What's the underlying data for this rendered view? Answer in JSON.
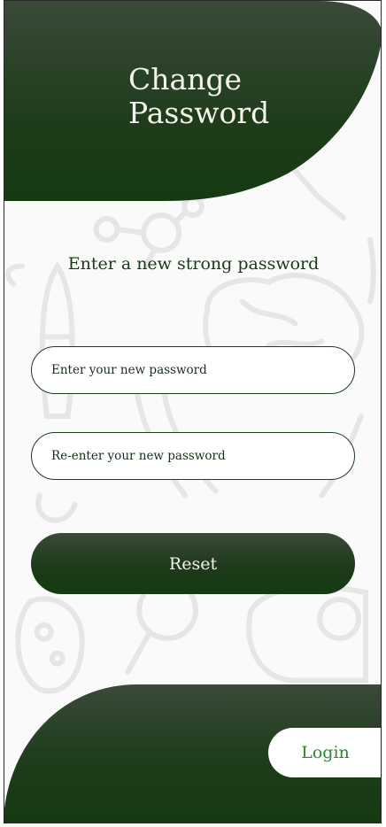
{
  "header": {
    "title_line1": "Change",
    "title_line2": "Password"
  },
  "form": {
    "subtitle": "Enter a new strong password",
    "new_password_placeholder": "Enter your new password",
    "confirm_password_placeholder": "Re-enter your new password",
    "reset_label": "Reset"
  },
  "footer": {
    "login_label": "Login"
  },
  "colors": {
    "brand_dark_green": "#163a12",
    "brand_mid_green": "#3a4a38",
    "login_text_green": "#2a8a2a",
    "doodle_gray": "#e3e3e3"
  }
}
